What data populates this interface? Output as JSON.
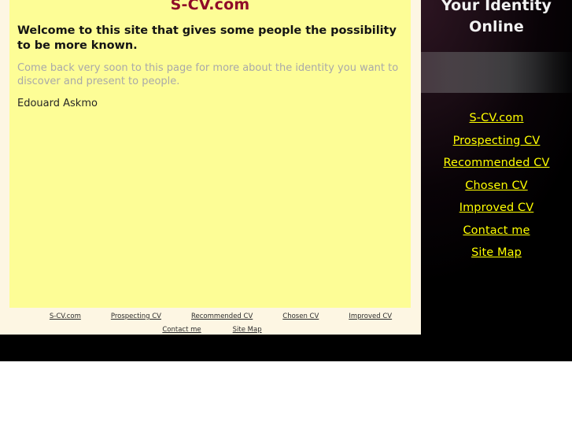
{
  "site": {
    "title": "S-CV.com"
  },
  "content": {
    "welcome_heading": "Welcome to this site that gives some people the possibility to be more known.",
    "intro_paragraph": "Come back very soon to this page for more about the identity you want to discover and present to people.",
    "signature": "Edouard Askmo"
  },
  "side_panel": {
    "heading": "Your Identity Online",
    "links": [
      {
        "label": "S-CV.com"
      },
      {
        "label": "Prospecting CV"
      },
      {
        "label": "Recommended CV"
      },
      {
        "label": "Chosen CV"
      },
      {
        "label": "Improved CV"
      },
      {
        "label": "Contact me"
      },
      {
        "label": "Site Map"
      }
    ]
  },
  "footer": {
    "row_1": [
      {
        "label": "S-CV.com"
      },
      {
        "label": "Prospecting CV"
      },
      {
        "label": "Recommended CV"
      },
      {
        "label": "Chosen CV"
      },
      {
        "label": "Improved CV"
      }
    ],
    "row_2": [
      {
        "label": "Contact me"
      },
      {
        "label": "Site Map"
      }
    ]
  },
  "colors": {
    "content_background": "#fdfd96",
    "page_background": "#fdf6e3",
    "title_red": "#8f0a28",
    "panel_link_yellow": "#ffff00",
    "panel_background": "#000000",
    "muted_text": "#a9a9a9"
  }
}
